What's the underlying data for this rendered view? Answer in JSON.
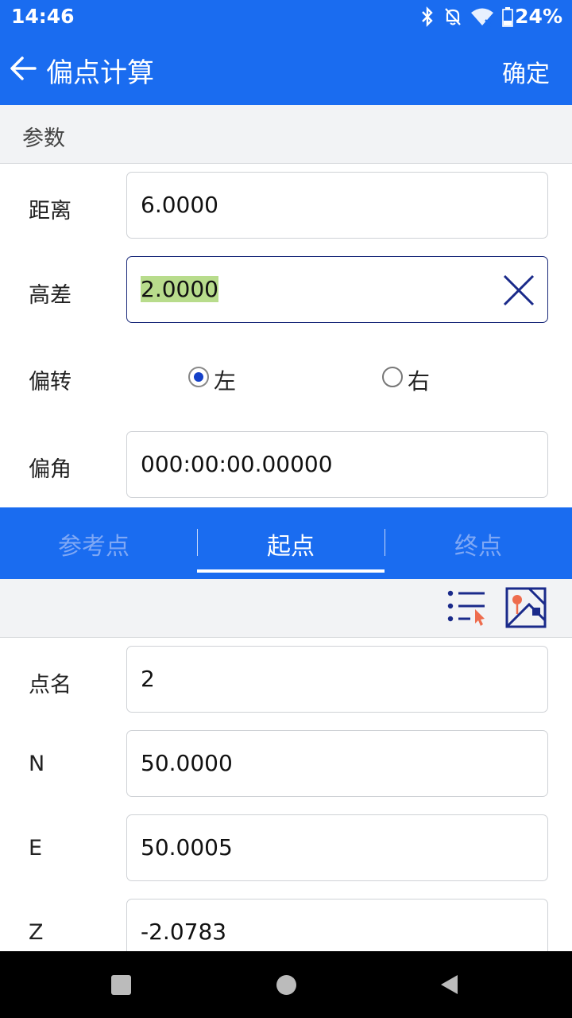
{
  "status_bar": {
    "time": "14:46",
    "battery": "24%"
  },
  "appbar": {
    "title": "偏点计算",
    "confirm_label": "确定"
  },
  "params_section": {
    "title": "参数"
  },
  "params": {
    "distance": {
      "label": "距离",
      "value": "6.0000"
    },
    "height_diff": {
      "label": "高差",
      "value": "2.0000"
    },
    "deflection": {
      "label": "偏转",
      "options": [
        "左",
        "右"
      ],
      "selected": "左"
    },
    "deflection_angle": {
      "label": "偏角",
      "value": "000:00:00.00000"
    }
  },
  "tabs": [
    {
      "label": "参考点",
      "active": false
    },
    {
      "label": "起点",
      "active": true
    },
    {
      "label": "终点",
      "active": false
    }
  ],
  "point": {
    "name": {
      "label": "点名",
      "value": "2"
    },
    "n": {
      "label": "N",
      "value": "50.0000"
    },
    "e": {
      "label": "E",
      "value": "50.0005"
    },
    "z": {
      "label": "Z",
      "value": "-2.0783"
    }
  },
  "colors": {
    "primary": "#1a6cf0",
    "section_bg": "#f2f3f5",
    "selection": "#b8dc8c",
    "radio_on": "#1440c8"
  }
}
